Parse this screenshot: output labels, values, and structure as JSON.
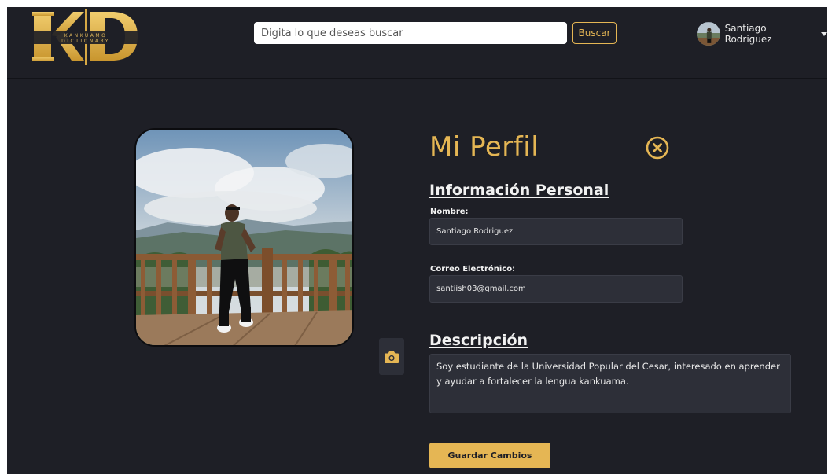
{
  "header": {
    "search": {
      "placeholder": "Digita lo que deseas buscar",
      "value": ""
    },
    "search_button_label": "Buscar",
    "user": {
      "name": "Santiago Rodriguez"
    }
  },
  "profile": {
    "title": "Mi Perfil",
    "personal_section_title": "Información Personal",
    "name": {
      "label": "Nombre:",
      "value": "Santiago Rodriguez"
    },
    "email": {
      "label": "Correo Electrónico:",
      "value": "santiish03@gmail.com"
    },
    "description": {
      "title": "Descripción",
      "value": "Soy estudiante de la Universidad Popular del Cesar, interesado en aprender y ayudar a fortalecer la lengua kankuama."
    },
    "save_button_label": "Guardar Cambios"
  },
  "icons": {
    "close": "close-circle-icon",
    "camera": "camera-icon",
    "caret": "caret-down-icon"
  },
  "colors": {
    "accent": "#e5b654",
    "background": "#1e1f26",
    "field_background": "#2d2f38",
    "text": "#f2f2f2"
  }
}
